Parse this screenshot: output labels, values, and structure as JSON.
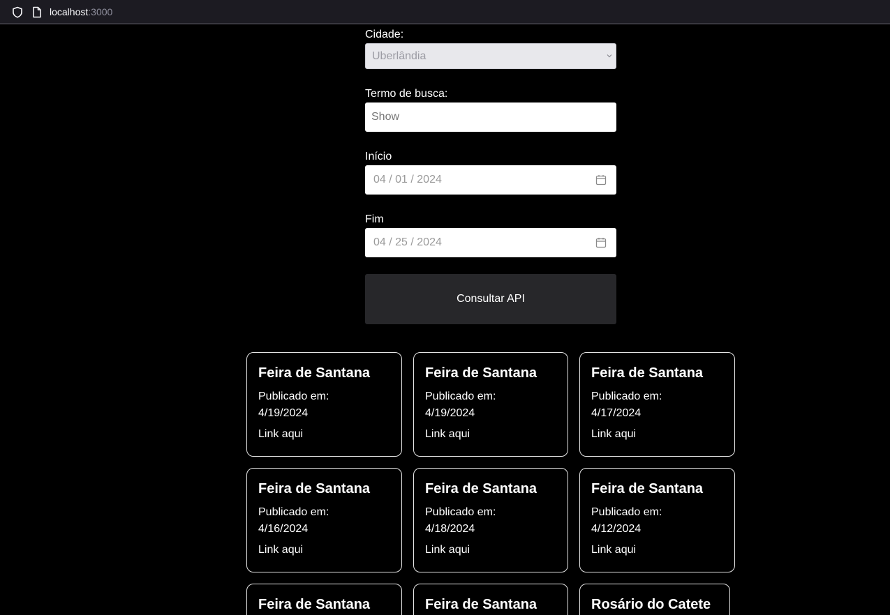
{
  "browser": {
    "url_host": "localhost",
    "url_port": ":3000"
  },
  "form": {
    "city_label": "Cidade:",
    "city_value": "Uberlândia",
    "search_label": "Termo de busca:",
    "search_value": "Show",
    "start_label": "Início",
    "start_value": "04 / 01 / 2024",
    "end_label": "Fim",
    "end_value": "04 / 25 / 2024",
    "submit_label": "Consultar API"
  },
  "results": [
    {
      "title": "Feira de Santana",
      "published_label": "Publicado em:",
      "date": "4/19/2024",
      "link_label": "Link aqui"
    },
    {
      "title": "Feira de Santana",
      "published_label": "Publicado em:",
      "date": "4/19/2024",
      "link_label": "Link aqui"
    },
    {
      "title": "Feira de Santana",
      "published_label": "Publicado em:",
      "date": "4/17/2024",
      "link_label": "Link aqui"
    },
    {
      "title": "Feira de Santana",
      "published_label": "Publicado em:",
      "date": "4/16/2024",
      "link_label": "Link aqui"
    },
    {
      "title": "Feira de Santana",
      "published_label": "Publicado em:",
      "date": "4/18/2024",
      "link_label": "Link aqui"
    },
    {
      "title": "Feira de Santana",
      "published_label": "Publicado em:",
      "date": "4/12/2024",
      "link_label": "Link aqui"
    },
    {
      "title": "Feira de Santana"
    },
    {
      "title": "Feira de Santana"
    },
    {
      "title": "Rosário do Catete"
    }
  ]
}
